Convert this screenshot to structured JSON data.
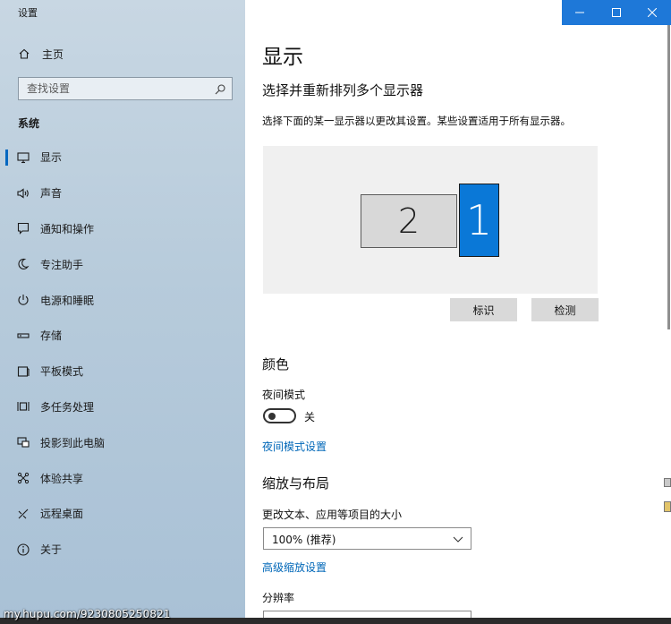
{
  "app": {
    "title": "设置"
  },
  "sidebar": {
    "home_label": "主页",
    "search_placeholder": "查找设置",
    "section_heading": "系统",
    "items": [
      {
        "label": "显示",
        "icon": "monitor-icon",
        "active": true
      },
      {
        "label": "声音",
        "icon": "speaker-icon",
        "active": false
      },
      {
        "label": "通知和操作",
        "icon": "notification-icon",
        "active": false
      },
      {
        "label": "专注助手",
        "icon": "moon-icon",
        "active": false
      },
      {
        "label": "电源和睡眠",
        "icon": "power-icon",
        "active": false
      },
      {
        "label": "存储",
        "icon": "storage-icon",
        "active": false
      },
      {
        "label": "平板模式",
        "icon": "tablet-icon",
        "active": false
      },
      {
        "label": "多任务处理",
        "icon": "multitask-icon",
        "active": false
      },
      {
        "label": "投影到此电脑",
        "icon": "project-icon",
        "active": false
      },
      {
        "label": "体验共享",
        "icon": "share-icon",
        "active": false
      },
      {
        "label": "远程桌面",
        "icon": "remote-desktop-icon",
        "active": false
      },
      {
        "label": "关于",
        "icon": "info-icon",
        "active": false
      }
    ]
  },
  "content": {
    "page_title": "显示",
    "arrange_heading": "选择并重新排列多个显示器",
    "arrange_description": "选择下面的某一显示器以更改其设置。某些设置适用于所有显示器。",
    "monitors": {
      "secondary_label": "2",
      "primary_label": "1"
    },
    "identify_button": "标识",
    "detect_button": "检测",
    "color_heading": "颜色",
    "night_mode_label": "夜间模式",
    "night_mode_state": "关",
    "night_mode_link": "夜间模式设置",
    "scale_heading": "缩放与布局",
    "scale_label": "更改文本、应用等项目的大小",
    "scale_value": "100% (推荐)",
    "advanced_scale_link": "高级缩放设置",
    "resolution_label": "分辨率"
  },
  "colors": {
    "accent": "#0078d7",
    "link": "#0067b8",
    "titlebar_buttons": "#1e78d8"
  },
  "watermark": "my.hupu.com/9230805250821"
}
